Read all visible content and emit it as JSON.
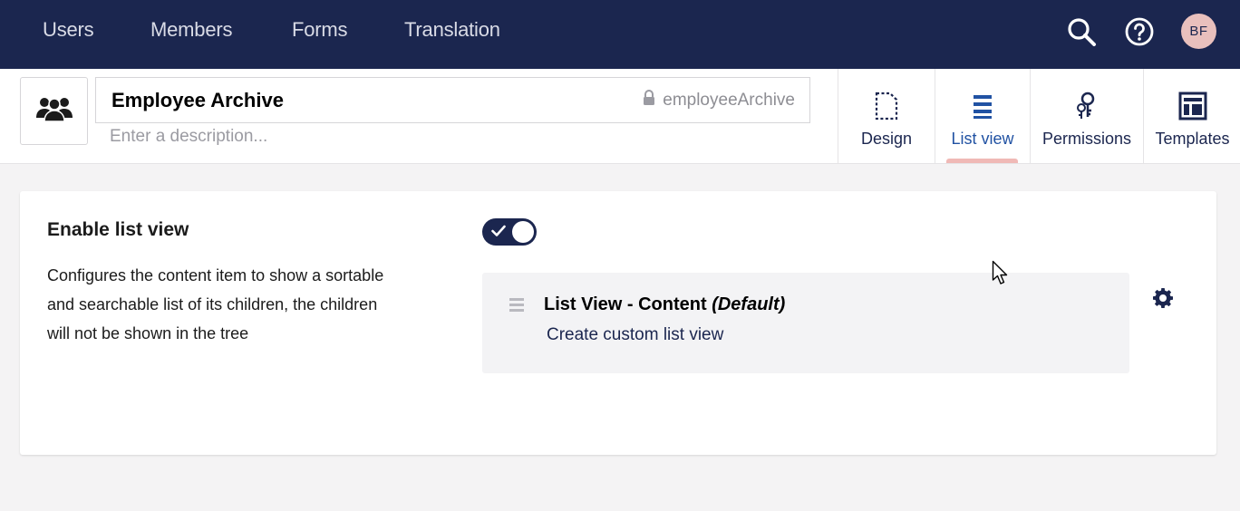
{
  "topnav": {
    "items": [
      {
        "label": "Users"
      },
      {
        "label": "Members"
      },
      {
        "label": "Forms"
      },
      {
        "label": "Translation"
      }
    ],
    "search_icon": "search-icon",
    "help_icon": "help-icon",
    "avatar_initials": "BF"
  },
  "header": {
    "icon": "users-group-icon",
    "name_value": "Employee Archive",
    "alias": "employeeArchive",
    "description_placeholder": "Enter a description...",
    "tabs": [
      {
        "label": "Design",
        "icon": "document-dashed-icon"
      },
      {
        "label": "List view",
        "icon": "list-icon",
        "active": true
      },
      {
        "label": "Permissions",
        "icon": "keys-icon"
      },
      {
        "label": "Templates",
        "icon": "layout-icon"
      }
    ]
  },
  "panel": {
    "title": "Enable list view",
    "description": "Configures the content item to show a sortable and searchable list of its children, the children will not be shown in the tree",
    "toggle_on": true,
    "list_view": {
      "name": "List View - Content",
      "suffix": "(Default)",
      "link": "Create custom list view"
    }
  },
  "colors": {
    "nav_bg": "#1b264f",
    "accent": "#f0b9b6",
    "active_tab": "#2152a3",
    "avatar_bg": "#e9c0bd"
  }
}
